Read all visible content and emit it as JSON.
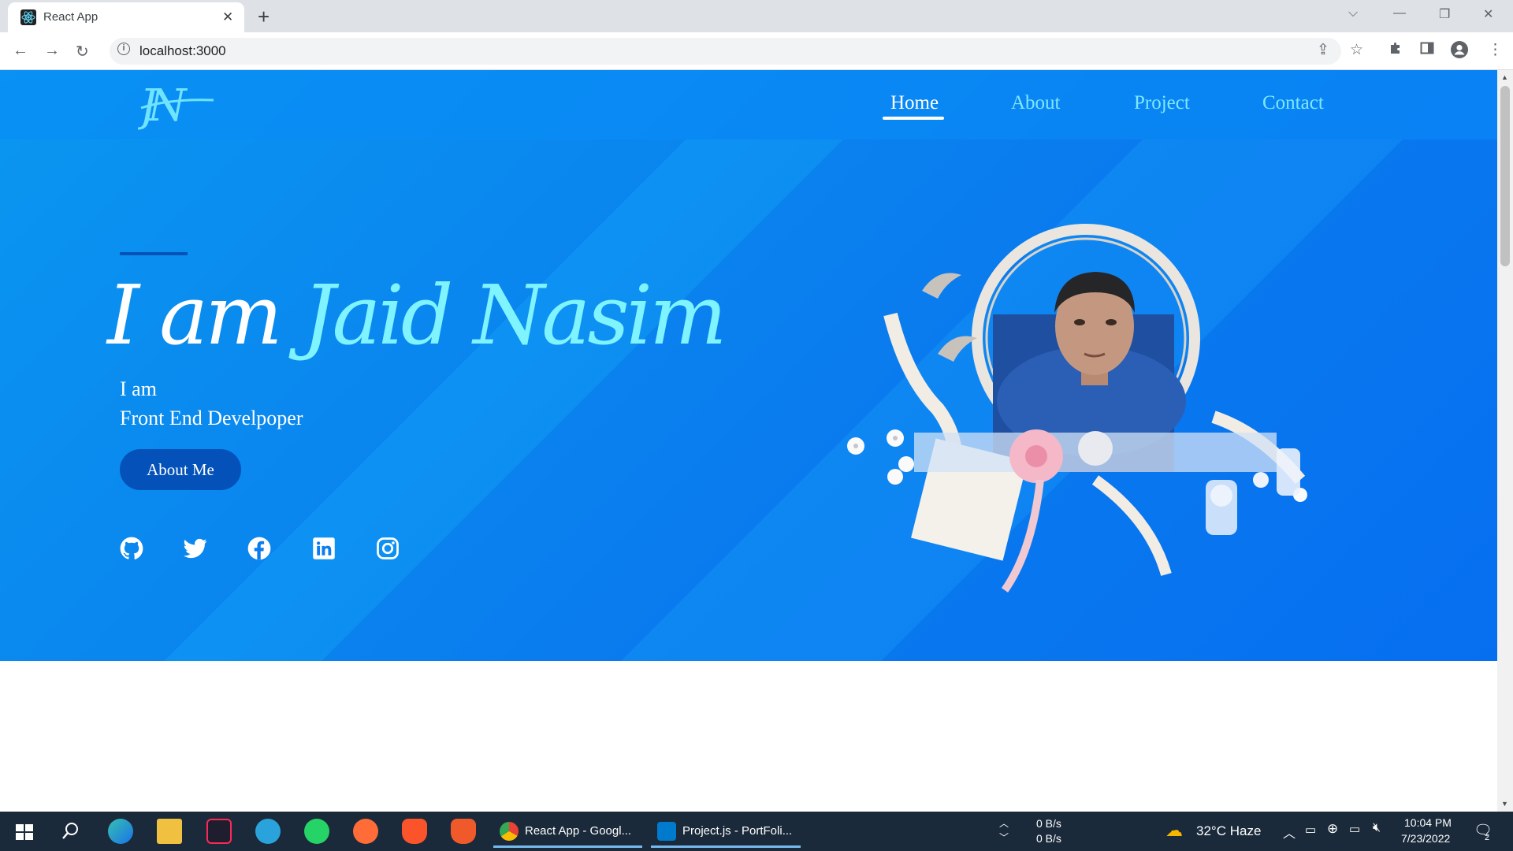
{
  "browser": {
    "tab_title": "React App",
    "tab_close": "✕",
    "new_tab": "+",
    "url": "localhost:3000",
    "info_glyph": "i"
  },
  "nav": {
    "items": [
      {
        "label": "Home",
        "active": true
      },
      {
        "label": "About",
        "active": false
      },
      {
        "label": "Project",
        "active": false
      },
      {
        "label": "Contact",
        "active": false
      }
    ],
    "logo_text": "JN"
  },
  "hero": {
    "name_word1": "I am",
    "name_word2": "Jaid Nasim",
    "intro": "I am",
    "role": "Front End Develpoper",
    "cta_label": "About Me",
    "social_icons": [
      "github-icon",
      "twitter-icon",
      "facebook-icon",
      "linkedin-icon",
      "instagram-icon"
    ]
  },
  "taskbar": {
    "windows": [
      {
        "label": "React App - Googl...",
        "icon": "chrome-icon"
      },
      {
        "label": "Project.js - PortFoli...",
        "icon": "vscode-icon"
      }
    ],
    "network_up": "0 B/s",
    "network_down": "0 B/s",
    "weather": "32°C  Haze",
    "time": "10:04 PM",
    "date": "7/23/2022",
    "notifications": "2"
  },
  "colors": {
    "hero_blue": "#0a7cee",
    "accent_dark": "#0451b9",
    "name_cyan": "#7ff4ff"
  }
}
